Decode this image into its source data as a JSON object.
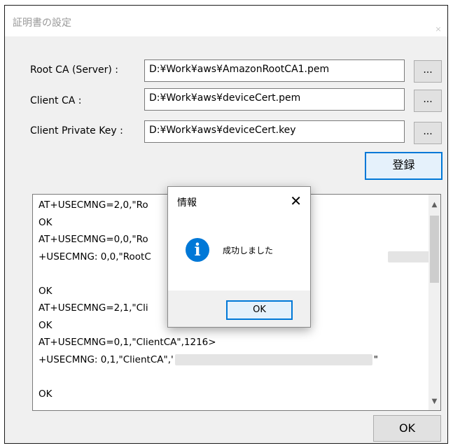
{
  "window": {
    "title": "証明書の設定",
    "close_glyph": "×"
  },
  "rows": [
    {
      "label": "Root CA (Server) :",
      "path": "D:¥Work¥aws¥AmazonRootCA1.pem",
      "browse": "..."
    },
    {
      "label": "Client CA :",
      "path": "D:¥Work¥aws¥deviceCert.pem",
      "browse": "..."
    },
    {
      "label": "Client Private Key :",
      "path": "D:¥Work¥aws¥deviceCert.key",
      "browse": "..."
    }
  ],
  "register_button": "登録",
  "log": {
    "lines": [
      "AT+USECMNG=2,0,\"Ro",
      "OK",
      "AT+USECMNG=0,0,\"Ro",
      "+USECMNG: 0,0,\"RootC",
      "",
      "OK",
      "AT+USECMNG=2,1,\"Cli",
      "OK",
      "AT+USECMNG=0,1,\"ClientCA\",1216>",
      "+USECMNG: 0,1,\"ClientCA\",'",
      "",
      "OK"
    ],
    "line4_tail": "\"",
    "line10_tail": "\""
  },
  "ok_button": "OK",
  "dialog": {
    "title": "情報",
    "close_glyph": "✕",
    "icon_glyph": "i",
    "message": "成功しました",
    "ok_button": "OK"
  },
  "icons": {
    "scroll_up": "up-arrow-icon",
    "scroll_down": "down-arrow-icon",
    "info": "info-icon"
  },
  "colors": {
    "accent": "#0078d7",
    "window_bg": "#f0f0f0"
  }
}
